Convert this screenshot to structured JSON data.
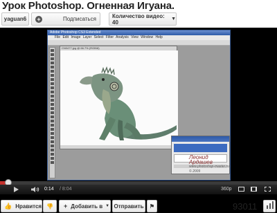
{
  "page_title": "Урок Photoshop. Огненная Игуана.",
  "channel": {
    "username": "yaguan6",
    "subscribe_label": "Подписаться",
    "video_count_label": "Количество видео: 40"
  },
  "video": {
    "photoshop": {
      "window_title": "Adobe Photoshop CS3 Extended",
      "menu": "File Edit Image Layer Select Filter Analysis View Window Help",
      "doc_title": "CN0477.jpg @ 66.7% (RGB/8)"
    },
    "watermark": {
      "line1": "Леонид Ардашев",
      "line2": "www.photoshop-master.ru",
      "line3": "© 2009"
    },
    "progress_fraction": 0.0289,
    "current_time": "0:14",
    "total_time": "/ 8:04",
    "quality": "360p"
  },
  "actions": {
    "like_label": "Нравится",
    "add_label": "Добавить в",
    "send_label": "Отправить"
  },
  "view_count": "93011",
  "colors": {
    "progress": "#c4302b",
    "accent_blue": "#2e5aa8"
  }
}
